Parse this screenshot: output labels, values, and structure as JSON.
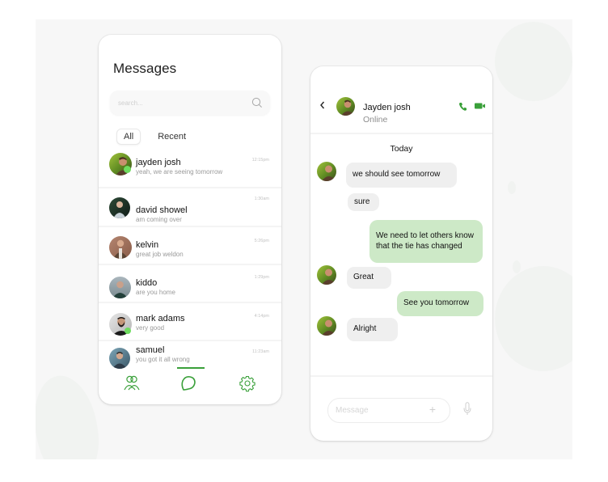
{
  "colors": {
    "accent": "#3aa03a",
    "online": "#6edc5f",
    "outgoing_bubble": "#cde9c7",
    "incoming_bubble": "#efefef"
  },
  "messages_screen": {
    "title": "Messages",
    "search": {
      "placeholder": "search...",
      "value": "",
      "icon": "search-icon"
    },
    "tabs": [
      {
        "label": "All",
        "active": true
      },
      {
        "label": "Recent",
        "active": false
      }
    ],
    "conversations": [
      {
        "name": "jayden josh",
        "preview": "yeah, we are seeing tomorrow",
        "time": "12:15pm",
        "online": true
      },
      {
        "name": "david showel",
        "preview": "am coming over",
        "time": "1:30am",
        "online": false
      },
      {
        "name": "kelvin",
        "preview": "great job weldon",
        "time": "5:26pm",
        "online": false
      },
      {
        "name": "kiddo",
        "preview": "are you home",
        "time": "1:29pm",
        "online": false
      },
      {
        "name": "mark adams",
        "preview": "very good",
        "time": "4:14pm",
        "online": true
      },
      {
        "name": "samuel",
        "preview": "you got it all wrong",
        "time": "11:23am",
        "online": false
      }
    ],
    "bottom_nav": [
      {
        "icon": "contacts-icon",
        "active": false
      },
      {
        "icon": "chat-bubble-icon",
        "active": true
      },
      {
        "icon": "settings-gear-icon",
        "active": false
      }
    ]
  },
  "chat_screen": {
    "contact_name": "Jayden josh",
    "status": "Online",
    "header_icons": [
      "back-chevron-icon",
      "phone-call-icon",
      "video-call-icon"
    ],
    "day_label": "Today",
    "messages": [
      {
        "direction": "in",
        "text": "we should see tomorrow",
        "avatar": true
      },
      {
        "direction": "in",
        "text": "sure",
        "avatar": false
      },
      {
        "direction": "out",
        "text": "We need to let others know\nthat the tie has  changed"
      },
      {
        "direction": "in",
        "text": "Great",
        "avatar": true
      },
      {
        "direction": "out",
        "text": "See you tomorrow"
      },
      {
        "direction": "in",
        "text": "Alright",
        "avatar": true
      }
    ],
    "composer": {
      "placeholder": "Message",
      "value": "",
      "attach_label": "+",
      "mic_icon": "microphone-icon"
    }
  }
}
